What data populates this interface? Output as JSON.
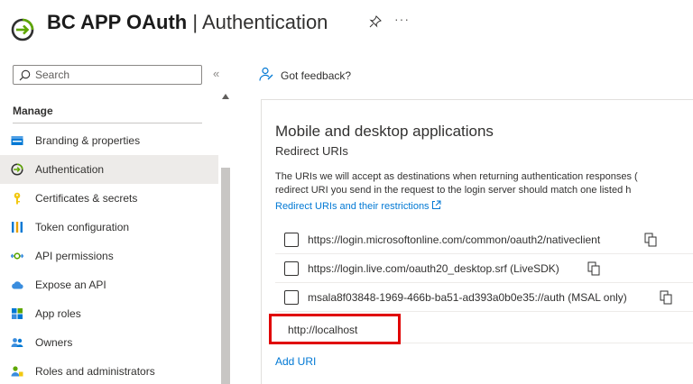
{
  "header": {
    "app_name": "BC APP OAuth",
    "separator": "|",
    "page_title": "Authentication",
    "more": "···"
  },
  "sidebar": {
    "search_placeholder": "Search",
    "collapse": "«",
    "section": "Manage",
    "items": [
      {
        "label": "Branding & properties",
        "icon": "branding-icon"
      },
      {
        "label": "Authentication",
        "icon": "authentication-icon",
        "active": true
      },
      {
        "label": "Certificates & secrets",
        "icon": "key-icon"
      },
      {
        "label": "Token configuration",
        "icon": "token-config-icon"
      },
      {
        "label": "API permissions",
        "icon": "api-permissions-icon"
      },
      {
        "label": "Expose an API",
        "icon": "cloud-icon"
      },
      {
        "label": "App roles",
        "icon": "app-roles-icon"
      },
      {
        "label": "Owners",
        "icon": "owners-icon"
      },
      {
        "label": "Roles and administrators",
        "icon": "roles-admin-icon"
      }
    ]
  },
  "main": {
    "feedback": "Got feedback?",
    "section_title": "Mobile and desktop applications",
    "section_subtitle": "Redirect URIs",
    "description_line1": "The URIs we will accept as destinations when returning authentication responses (",
    "description_line2": "redirect URI you send in the request to the login server should match one listed h",
    "link": "Redirect URIs and their restrictions",
    "uris": [
      "https://login.microsoftonline.com/common/oauth2/nativeclient",
      "https://login.live.com/oauth20_desktop.srf (LiveSDK)",
      "msala8f03848-1969-466b-ba51-ad393a0b0e35://auth (MSAL only)"
    ],
    "new_uri_value": "http://localhost",
    "add_uri": "Add URI"
  },
  "colors": {
    "accent": "#0078d4",
    "highlight_border": "#e00000",
    "active_nav": "#edebe9"
  }
}
